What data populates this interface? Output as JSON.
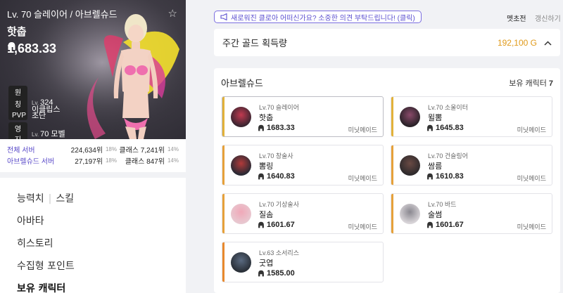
{
  "profile": {
    "title": "Lv. 70 슬레이어 / 아브렐슈드",
    "name": "핫춥",
    "item_level": "1,683.33",
    "stats": [
      {
        "label": "원정대",
        "prefix": "Lv.",
        "value": "324"
      },
      {
        "label": "칭호",
        "prefix": "",
        "value": "이클립스"
      },
      {
        "label": "PVP",
        "prefix": "",
        "value": "초단"
      },
      {
        "label": "영지",
        "prefix": "Lv.",
        "value": "70 모벨"
      }
    ],
    "ranks": [
      {
        "label": "전체 서버",
        "rank": "224,634위",
        "pct": "18%",
        "class_rank": "클래스 7,241위",
        "class_pct": "14%"
      },
      {
        "label": "아브렐슈드 서버",
        "rank": "27,197위",
        "pct": "18%",
        "class_rank": "클래스 847위",
        "class_pct": "14%"
      }
    ]
  },
  "nav": {
    "ability": "능력치",
    "skill": "스킬",
    "avatar": "아바타",
    "history": "히스토리",
    "collectibles": "수집형 포인트",
    "characters": "보유 캐릭터"
  },
  "topbar": {
    "notice": "새로워진 클로아 어떠신가요? 소중한 의견 부탁드립니다! (클릭)",
    "visitor_name": "멧초전",
    "refresh": "갱신하기"
  },
  "gold": {
    "label": "주간 골드 획득량",
    "value": "192,100 G"
  },
  "characters": {
    "server": "아브렐슈드",
    "owned_label": "보유 캐릭터",
    "owned_count": "7",
    "items": [
      {
        "class": "Lv.70 슬레이어",
        "name": "핫춥",
        "item_level": "1683.33",
        "guild": "미닛메이드",
        "bar_color": "#e2b23a",
        "selected": true
      },
      {
        "class": "Lv.70 소울이터",
        "name": "윌뽐",
        "item_level": "1645.83",
        "guild": "미닛메이드",
        "bar_color": "#e2b23a",
        "selected": false
      },
      {
        "class": "Lv.70 창술사",
        "name": "뽐링",
        "item_level": "1640.83",
        "guild": "미닛메이드",
        "bar_color": "#e6a13a",
        "selected": false
      },
      {
        "class": "Lv.70 건슬링어",
        "name": "쌈름",
        "item_level": "1610.83",
        "guild": "미닛메이드",
        "bar_color": "#e6a13a",
        "selected": false
      },
      {
        "class": "Lv.70 기상술사",
        "name": "질솜",
        "item_level": "1601.67",
        "guild": "미닛메이드",
        "bar_color": "#e6a13a",
        "selected": false
      },
      {
        "class": "Lv.70 바드",
        "name": "술썸",
        "item_level": "1601.67",
        "guild": "미닛메이드",
        "bar_color": "#e6a13a",
        "selected": false
      },
      {
        "class": "Lv.63 소서리스",
        "name": "굿엽",
        "item_level": "1585.00",
        "guild": "",
        "bar_color": "#e8892e",
        "selected": false
      }
    ]
  },
  "colors": {
    "accent_purple": "#5b4fd0",
    "gold": "#e09a1a"
  }
}
